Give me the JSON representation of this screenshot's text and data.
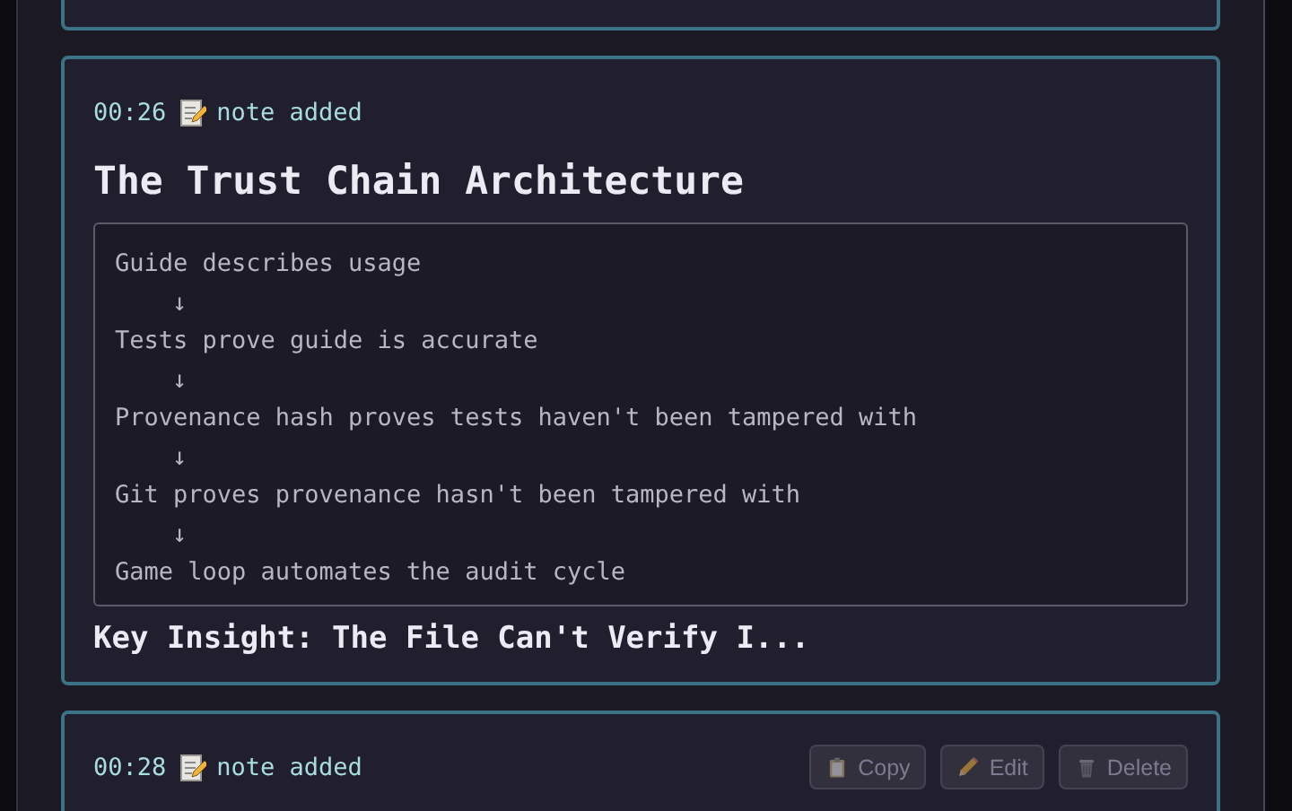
{
  "entries": [
    {
      "time": "00:26",
      "event": "note added",
      "title": "The Trust Chain Architecture",
      "flow": [
        {
          "kind": "step",
          "text": "Guide describes usage"
        },
        {
          "kind": "arrow",
          "text": "↓"
        },
        {
          "kind": "step",
          "text": "Tests prove guide is accurate"
        },
        {
          "kind": "arrow",
          "text": "↓"
        },
        {
          "kind": "step",
          "text": "Provenance hash proves tests haven't been tampered with"
        },
        {
          "kind": "arrow",
          "text": "↓"
        },
        {
          "kind": "step",
          "text": "Git proves provenance hasn't been tampered with"
        },
        {
          "kind": "arrow",
          "text": "↓"
        },
        {
          "kind": "step",
          "text": "Game loop automates the audit cycle"
        }
      ],
      "subheading": "Key Insight: The File Can't Verify I..."
    },
    {
      "time": "00:28",
      "event": "note added",
      "actions": [
        {
          "kind": "copy",
          "label": "Copy"
        },
        {
          "kind": "edit",
          "label": "Edit"
        },
        {
          "kind": "delete",
          "label": "Delete"
        }
      ]
    }
  ]
}
